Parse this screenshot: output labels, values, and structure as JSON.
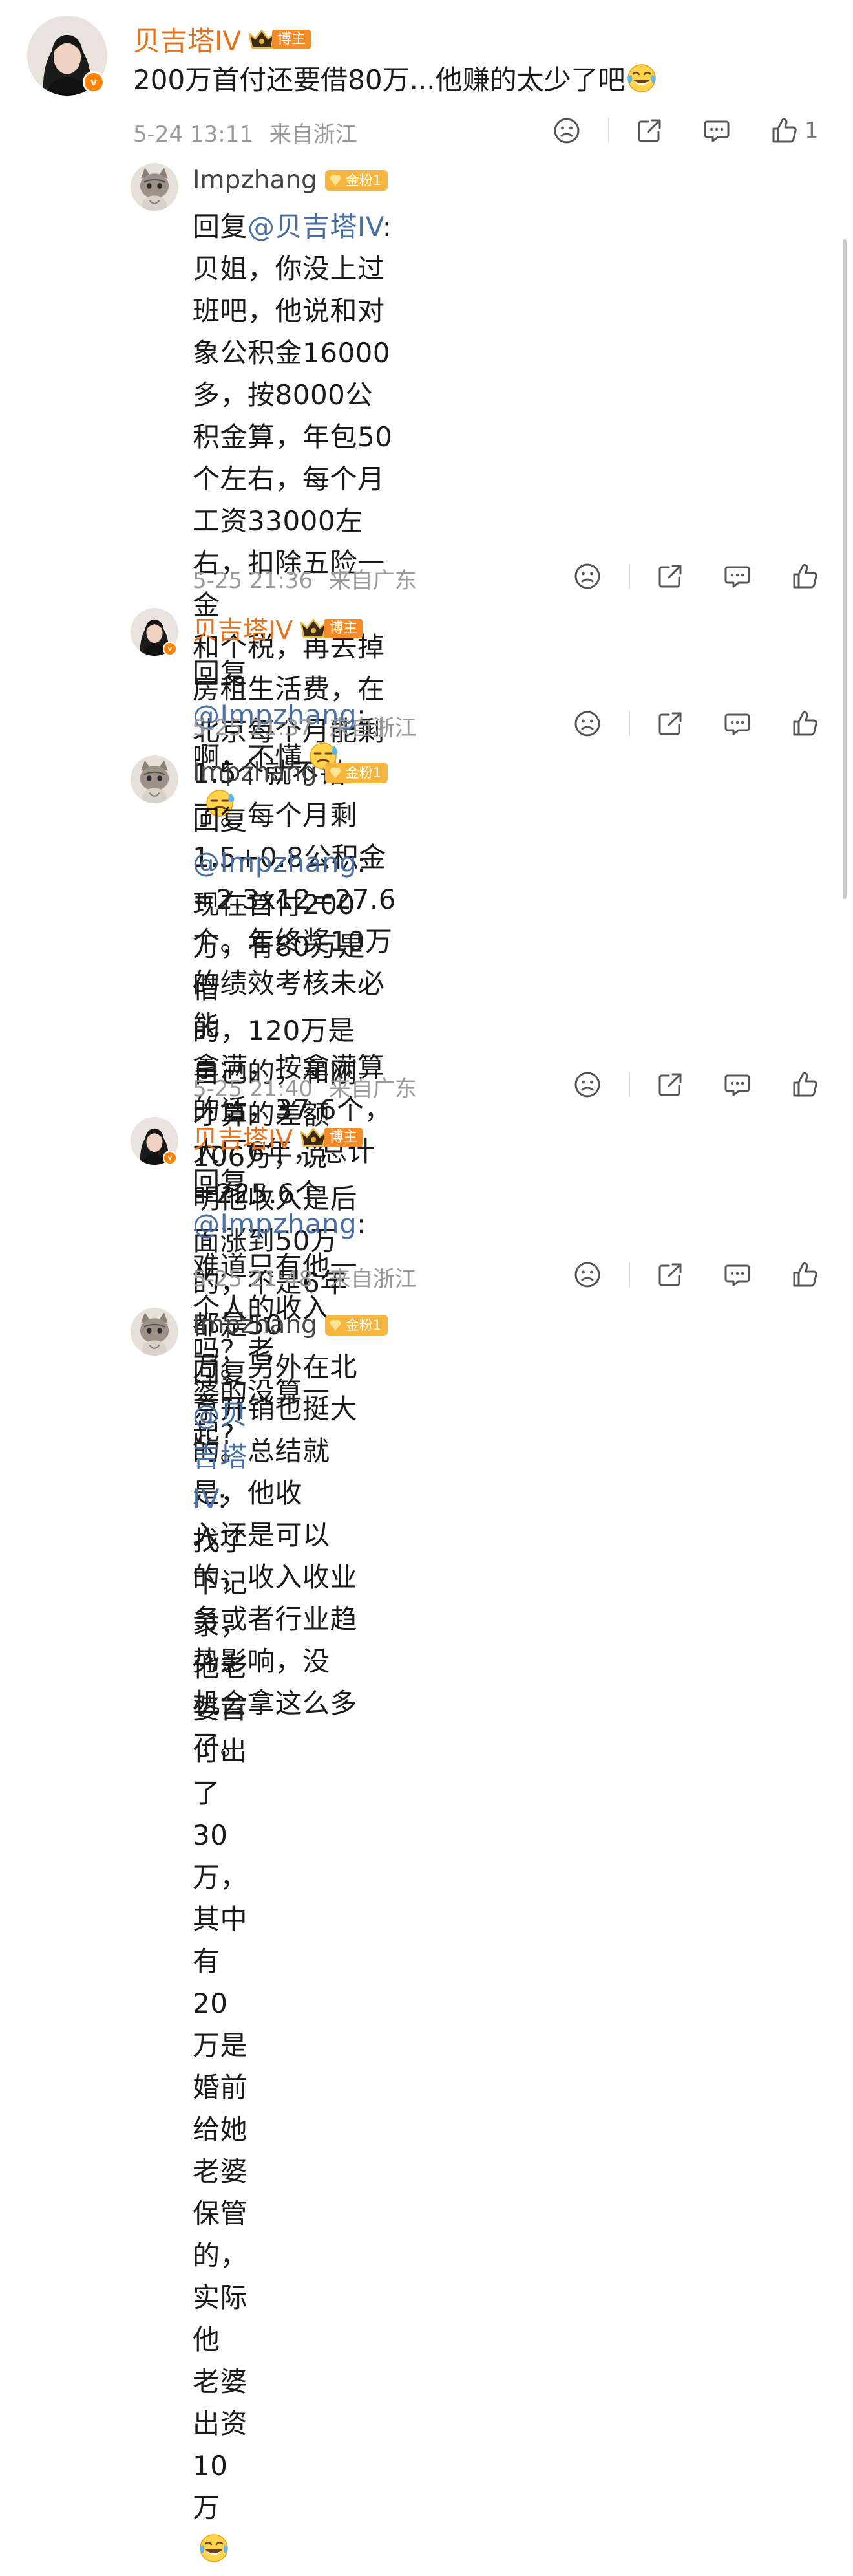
{
  "post": {
    "author": "贝吉塔IV",
    "author_badge": "博主",
    "text": "200万首付还要借80万...他赚的太少了吧",
    "time": "5-24 13:11",
    "source": "来自浙江",
    "like_count": "1",
    "text_emoji": "laugh-cry-emoji"
  },
  "replies": [
    {
      "author": "Impzhang",
      "badge": "金粉1",
      "reply_prefix": "回复",
      "mention": "@贝吉塔IV",
      "lines": [
        "回复@贝吉塔IV:贝姐，你没上过班吧，他说和对",
        "象公积金16000多，按8000公积金算，年包50",
        "个左右，每个月工资33000左右，扣除五险一金",
        "和个税，再去掉房租生活费，在北京每个月能剩",
        "1.5个就不错了。每个月剩1.5+0.8公积金",
        "=2.3x12=27.6个。年终奖10万的绩效考核未必能",
        "拿满，按拿满算的话，37.6个，大厂6年，总计",
        "=225.6个"
      ],
      "time": "5-25 21:36",
      "source": "来自广东"
    },
    {
      "author": "贝吉塔IV",
      "badge": "博主",
      "reply_prefix": "回复",
      "mention": "@Impzhang",
      "lines": [
        "回复@Impzhang:啊，不懂"
      ],
      "emojis": [
        "sweat-emoji",
        "sweat-emoji"
      ],
      "time": "5-25 21:37",
      "source": "来自浙江"
    },
    {
      "author": "Impzhang",
      "badge": "金粉1",
      "reply_prefix": "回复",
      "mention": "@Impzhang",
      "lines": [
        "回复@Impzhang:现在首付200万，有80万是借",
        "的，120万是自己的，和刚才算的差额106万，说",
        "明他收入是后面涨到50万的，不是6年都是50",
        "万。另外在北京开销也挺大的。总结就是，他收",
        "入还是可以的，收入收业务或者行业趋势影响，没",
        "机会拿这么多了。"
      ],
      "time": "5-25 21:40",
      "source": "来自广东"
    },
    {
      "author": "贝吉塔IV",
      "badge": "博主",
      "reply_prefix": "回复",
      "mention": "@Impzhang",
      "lines": [
        "回复@Impzhang:难道只有他一个人的收入吗？老",
        "婆的没算一起?"
      ],
      "time": "5-25 21:48",
      "source": "来自浙江"
    },
    {
      "author": "Impzhang",
      "badge": "金粉1",
      "reply_prefix": "回复",
      "mention": "@贝吉塔IV",
      "lines": [
        "回复@贝吉塔IV:找了下记录，他老婆首付出了30",
        "万，其中有20万是婚前给她老婆保管的，实际他",
        "老婆出资10万"
      ],
      "emojis": [
        "laugh-cry-emoji"
      ],
      "time": "",
      "source": ""
    }
  ],
  "colors": {
    "vip_orange": "#e8721c",
    "mention_blue": "#4a6fa5",
    "meta_gray": "#9a9a9a",
    "fan_badge": "#f6b53c"
  }
}
